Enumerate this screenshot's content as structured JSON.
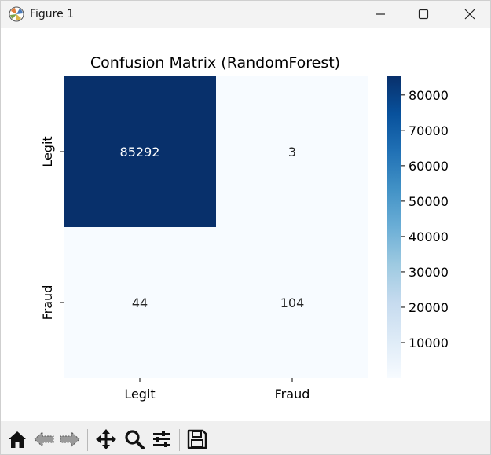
{
  "window": {
    "title": "Figure 1"
  },
  "toolbar": {
    "tools": [
      "home-icon",
      "back-icon",
      "forward-icon",
      "pan-icon",
      "zoom-icon",
      "configure-subplots-icon",
      "save-icon"
    ]
  },
  "chart_data": {
    "type": "heatmap",
    "title": "Confusion Matrix (RandomForest)",
    "xlabel": "",
    "ylabel": "",
    "x_categories": [
      "Legit",
      "Fraud"
    ],
    "y_categories": [
      "Legit",
      "Fraud"
    ],
    "values": [
      [
        85292,
        3
      ],
      [
        44,
        104
      ]
    ],
    "colormap": "Blues",
    "colorbar": {
      "min": 3,
      "max": 85292,
      "ticks": [
        10000,
        20000,
        30000,
        40000,
        50000,
        60000,
        70000,
        80000
      ]
    },
    "colors": {
      "low": "#f7fbff",
      "high": "#08306b",
      "text_on_dark": "#ffffff",
      "text_on_light": "#262626"
    }
  }
}
